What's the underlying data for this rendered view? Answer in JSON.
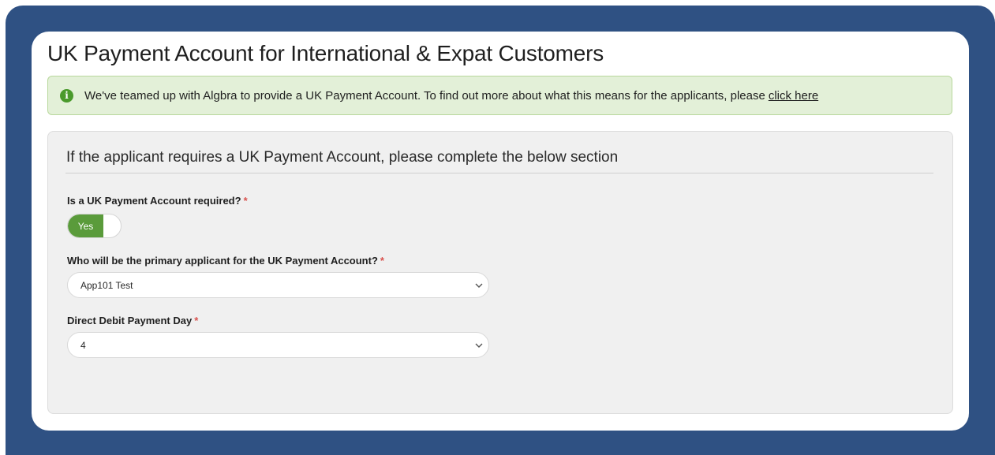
{
  "page": {
    "title": "UK Payment Account for International & Expat Customers"
  },
  "notice": {
    "icon": "info-icon",
    "icon_glyph": "i",
    "text": "We've teamed up with Algbra to provide a UK Payment Account. To find out more about what this means for the applicants, please",
    "link_text": "click here"
  },
  "panel": {
    "heading": "If the applicant requires a UK Payment Account, please complete the below section",
    "required_marker": "*",
    "fields": {
      "account_required": {
        "label": "Is a UK Payment Account required?",
        "toggle_label": "Yes",
        "value": true
      },
      "primary_applicant": {
        "label": "Who will be the primary applicant for the UK Payment Account?",
        "selected": "App101 Test"
      },
      "payment_day": {
        "label": "Direct Debit Payment Day",
        "selected": "4"
      }
    }
  },
  "colors": {
    "frame": "#2f5183",
    "notice_bg": "#e3f0d8",
    "toggle_on": "#5a9b3b",
    "required": "#d9534f"
  }
}
